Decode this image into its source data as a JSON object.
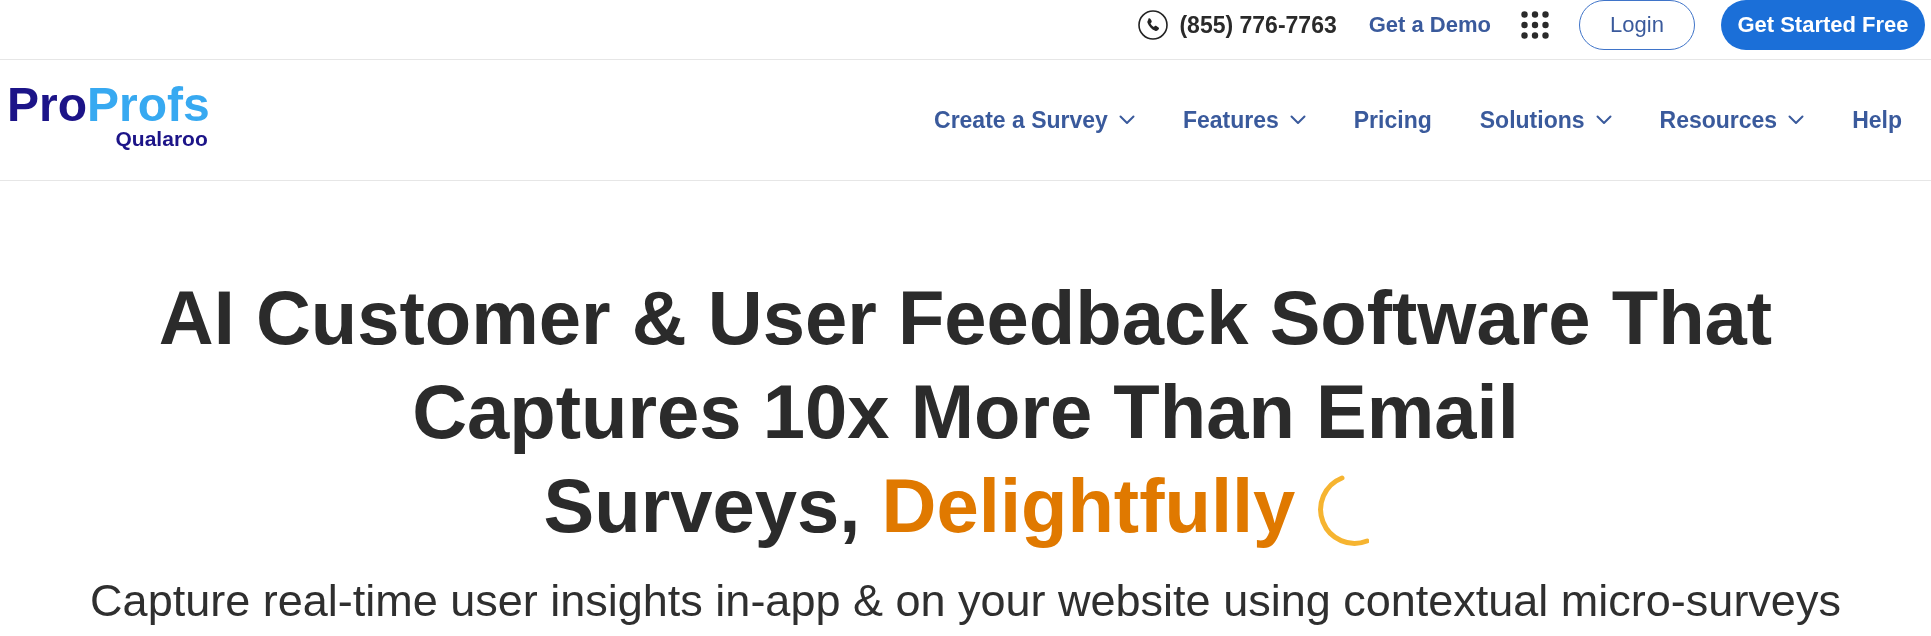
{
  "top_bar": {
    "phone": "(855) 776-7763",
    "demo_link": "Get a Demo",
    "login_button": "Login",
    "cta_button": "Get Started Free"
  },
  "logo": {
    "wordmark": [
      "Pro",
      "Profs"
    ],
    "product": "Qualaroo"
  },
  "nav": {
    "items": [
      {
        "label": "Create a Survey",
        "has_menu": true
      },
      {
        "label": "Features",
        "has_menu": true
      },
      {
        "label": "Pricing",
        "has_menu": false
      },
      {
        "label": "Solutions",
        "has_menu": true
      },
      {
        "label": "Resources",
        "has_menu": true
      },
      {
        "label": "Help",
        "has_menu": false
      }
    ]
  },
  "hero": {
    "headline_lines": [
      {
        "text": "AI Customer & User Feedback Software That"
      },
      {
        "text": "Captures 10x More Than Email"
      },
      {
        "text": "Surveys,",
        "highlight": "Delightfully"
      }
    ],
    "subtitle": "Capture real-time user insights in-app & on your website using contextual micro-surveys"
  }
}
